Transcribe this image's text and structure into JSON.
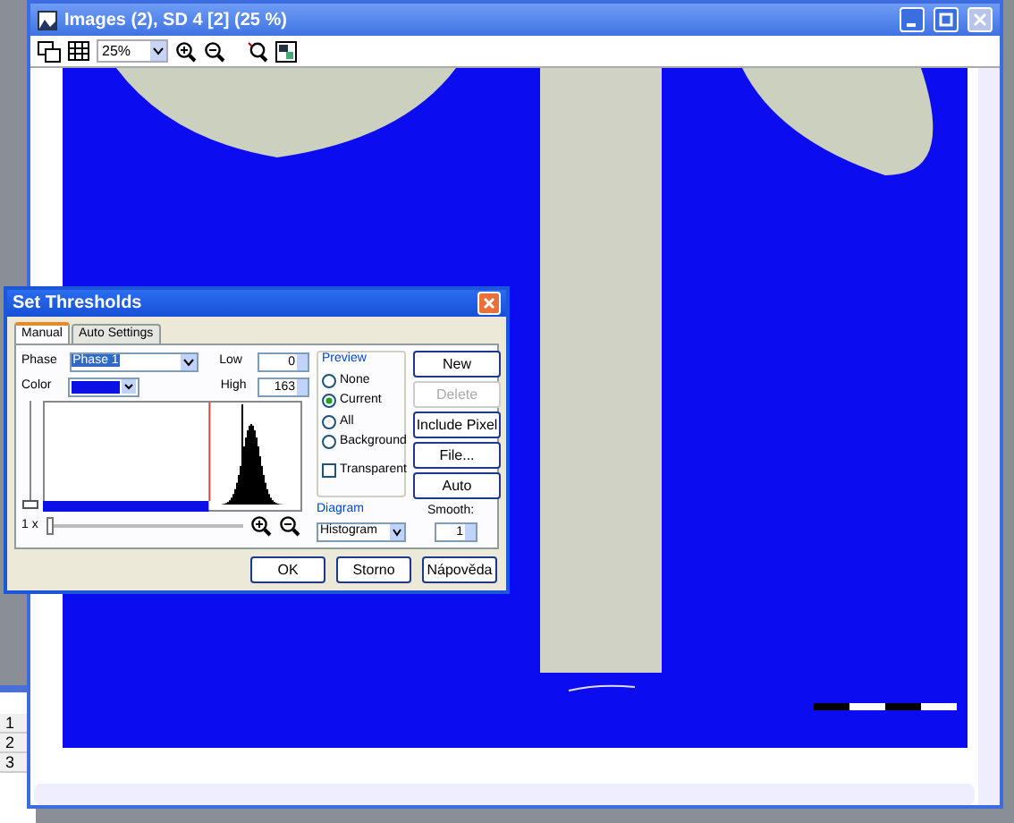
{
  "window": {
    "title": "Images (2), SD 4 [2] (25 %)",
    "zoom": "25%"
  },
  "dialog": {
    "title": "Set Thresholds",
    "tabs": [
      {
        "label": "Manual",
        "selected": true
      },
      {
        "label": "Auto Settings",
        "selected": false
      }
    ],
    "phase_label": "Phase",
    "phase": "Phase 1",
    "color_label": "Color",
    "color": "#0a10e6",
    "low_label": "Low",
    "low": "0",
    "high_label": "High",
    "high": "163",
    "zoom_label": "1 x",
    "zoom_slider": {
      "level": 0.0
    },
    "vertical_slider": {
      "level": 0.0
    },
    "preview": {
      "title": "Preview",
      "options": [
        {
          "label": "None",
          "selected": false
        },
        {
          "label": "Current",
          "selected": true
        },
        {
          "label": "All",
          "selected": false
        },
        {
          "label": "Background",
          "selected": false
        }
      ],
      "transparent": {
        "label": "Transparent",
        "checked": false
      }
    },
    "side_buttons": [
      {
        "label": "New",
        "disabled": false
      },
      {
        "label": "Delete",
        "disabled": true
      },
      {
        "label": "Include Pixel",
        "disabled": false
      },
      {
        "label": "File...",
        "disabled": false
      },
      {
        "label": "Auto",
        "disabled": false
      }
    ],
    "diagram": {
      "title": "Diagram",
      "value": "Histogram"
    },
    "smooth_label": "Smooth:",
    "smooth": "1",
    "buttons": [
      "OK",
      "Storno",
      "Nápověda"
    ]
  },
  "sheet_rows": [
    "1",
    "2",
    "3"
  ]
}
